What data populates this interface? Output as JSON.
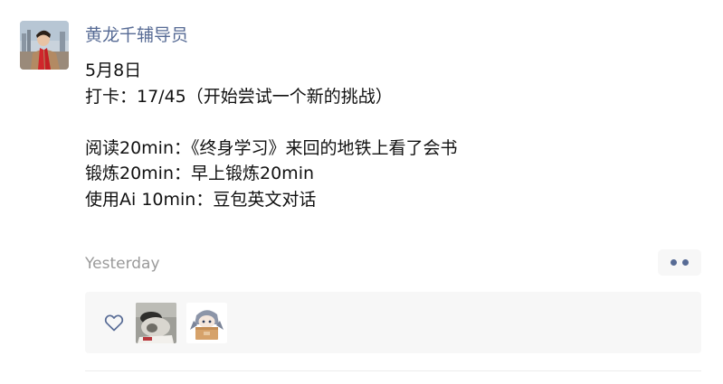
{
  "post": {
    "author": "黄龙千辅导员",
    "lines": [
      "5月8日",
      "打卡：17/45（开始尝试一个新的挑战）",
      "",
      "阅读20min：《终身学习》来回的地铁上看了会书",
      "锻炼20min：早上锻炼20min",
      "使用Ai 10min：豆包英文对话"
    ],
    "timestamp": "Yesterday"
  },
  "likes": {
    "icon": "heart-outline-icon",
    "avatars": [
      "avatar-photo-cat",
      "avatar-cartoon-character"
    ]
  },
  "colors": {
    "author_name": "#576b95",
    "timestamp": "#9a9a9a",
    "panel_bg": "#f7f7f7",
    "text": "#111111"
  }
}
